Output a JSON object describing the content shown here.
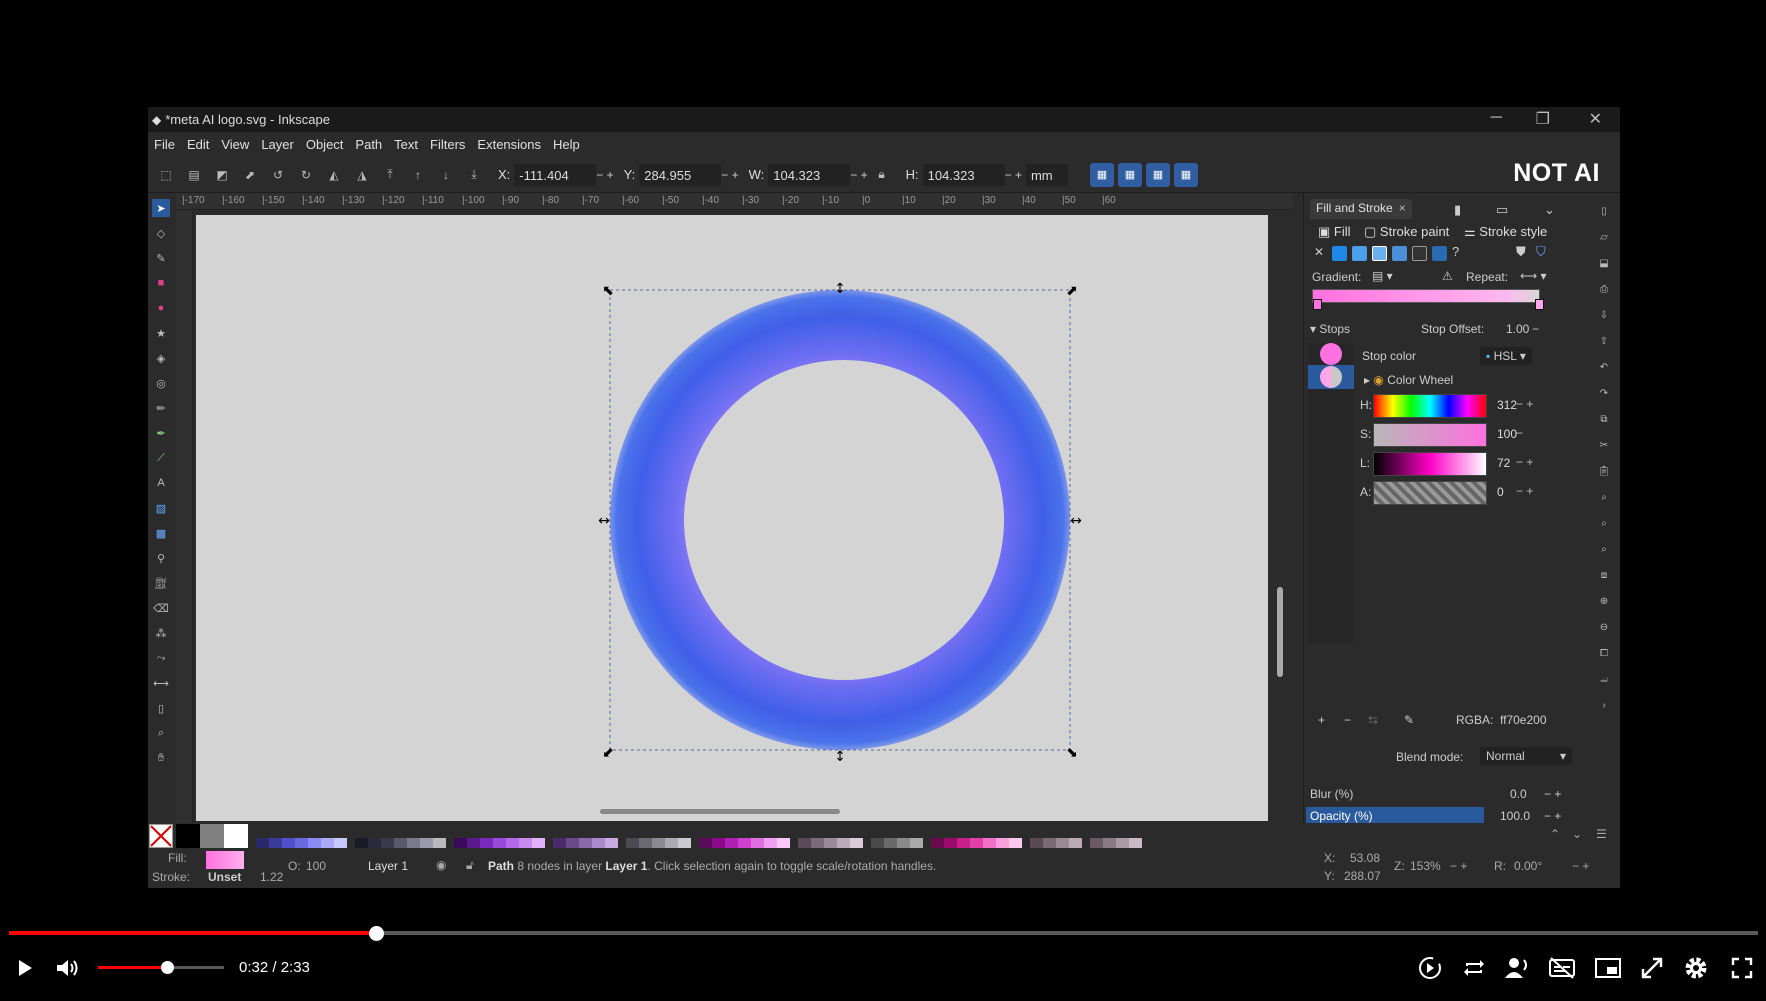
{
  "window": {
    "title": "*meta AI logo.svg - Inkscape",
    "minimize": "─",
    "restore": "❐",
    "close": "✕"
  },
  "menu": [
    "File",
    "Edit",
    "View",
    "Layer",
    "Object",
    "Path",
    "Text",
    "Filters",
    "Extensions",
    "Help"
  ],
  "toolbar": {
    "x_label": "X:",
    "x_value": "-111.404",
    "y_label": "Y:",
    "y_value": "284.955",
    "w_label": "W:",
    "w_value": "104.323",
    "h_label": "H:",
    "h_value": "104.323",
    "unit": "mm"
  },
  "watermark": "NOT AI",
  "ruler_top": [
    "-170",
    "-160",
    "-150",
    "-140",
    "-130",
    "-120",
    "-110",
    "-100",
    "-90",
    "-80",
    "-70",
    "-60",
    "-50",
    "-40",
    "-30",
    "-20",
    "-10",
    "0",
    "10",
    "20",
    "30",
    "40",
    "50",
    "60"
  ],
  "canvas_ring": {
    "outer_color": "#3f5fe8",
    "inner_color": "#8a78f0",
    "background": "#d4d4d4"
  },
  "panel": {
    "tab_label": "Fill and Stroke",
    "tab_close": "×",
    "sub_tabs": [
      "Fill",
      "Stroke paint",
      "Stroke style"
    ],
    "unset_icon": "✕",
    "help_icon": "?",
    "gradient_label": "Gradient:",
    "repeat_label": "Repeat:",
    "stops_label": "Stops",
    "stop_offset_label": "Stop Offset:",
    "stop_offset_value": "1.00",
    "stop_color_label": "Stop color",
    "color_mode": "HSL",
    "color_wheel_label": "Color Wheel",
    "sliders": [
      {
        "label": "H:",
        "value": "312"
      },
      {
        "label": "S:",
        "value": "100"
      },
      {
        "label": "L:",
        "value": "72"
      },
      {
        "label": "A:",
        "value": "0"
      }
    ],
    "rgba_label": "RGBA:",
    "rgba_value": "ff70e200",
    "blend_label": "Blend mode:",
    "blend_value": "Normal",
    "blur_label": "Blur (%)",
    "blur_value": "0.0",
    "opacity_label": "Opacity (%)",
    "opacity_value": "100.0",
    "stop_colors": [
      "#ff70e0",
      "#ffa6ea"
    ]
  },
  "status": {
    "fill_label": "Fill:",
    "stroke_label": "Stroke:",
    "stroke_value": "Unset",
    "stroke_width": "1.22",
    "opacity_label": "O:",
    "opacity_value": "100",
    "layer": "Layer 1",
    "message_bold": "Path",
    "message_layer": "Layer 1",
    "message_pre": " 8 nodes in layer ",
    "message_post": ". Click selection again to toggle scale/rotation handles.",
    "x_label": "X:",
    "x_value": "53.08",
    "y_label": "Y:",
    "y_value": "288.07",
    "z_label": "Z:",
    "z_value": "153%",
    "r_label": "R:",
    "r_value": "0.00°"
  },
  "player": {
    "time": "0:32 / 2:33",
    "progress": 0.21,
    "volume": 0.55,
    "accent": "#ff0000"
  }
}
